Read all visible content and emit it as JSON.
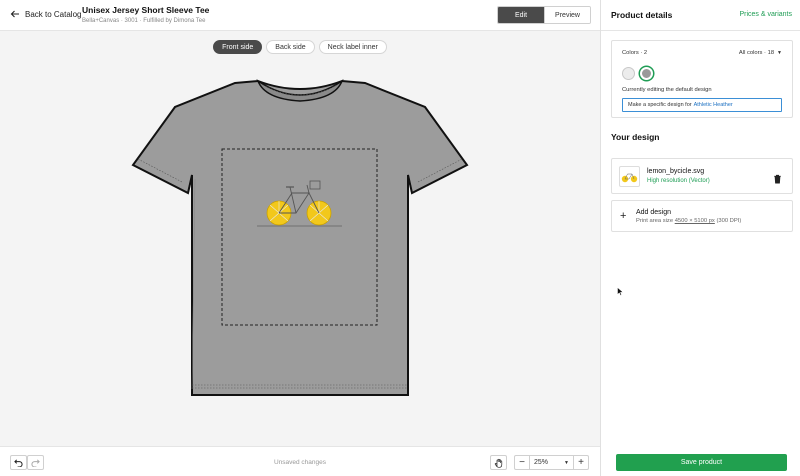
{
  "header": {
    "back_label": "Back to Catalog",
    "product_title": "Unisex Jersey Short Sleeve Tee",
    "product_subtitle": "Bella+Canvas · 3001 · Fulfilled by Dimona Tee",
    "edit_label": "Edit",
    "preview_label": "Preview"
  },
  "canvas": {
    "sides": [
      "Front side",
      "Back side",
      "Neck label inner"
    ],
    "active_side": "Front side",
    "shirt_color": "#9c9c9c"
  },
  "bottom_bar": {
    "unsaved_text": "Unsaved changes",
    "zoom_value": "25%",
    "zoom_out_symbol": "−",
    "zoom_in_symbol": "+"
  },
  "panel": {
    "title": "Product details",
    "prices_link": "Prices & variants",
    "colors_label": "Colors · 2",
    "all_colors_label": "All colors · 18",
    "editing_text": "Currently editing the default design",
    "specific_design_prefix": "Make a specific design for",
    "specific_design_color": "Athletic Heather",
    "your_design_title": "Your design",
    "file_name": "lemon_bycicle.svg",
    "file_resolution": "High resolution (Vector)",
    "add_design_title": "Add design",
    "add_design_prefix": "Print area size",
    "add_design_size": "4500 × 5100 px",
    "add_design_dpi": "(300 DPI)",
    "save_label": "Save product",
    "accent_color": "#21a04f"
  }
}
